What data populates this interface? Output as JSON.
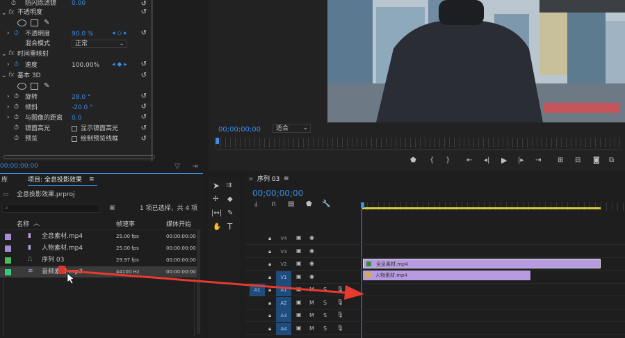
{
  "effect_controls": {
    "anti_flicker_label": "防闪烁滤镜",
    "anti_flicker_value": "0.00",
    "opacity_group": "不透明度",
    "opacity_label": "不透明度",
    "opacity_value": "90.0 %",
    "blend_label": "混合模式",
    "blend_value": "正常",
    "time_remap_group": "时间重映射",
    "speed_label": "速度",
    "speed_value": "100.00%",
    "basic3d_group": "基本 3D",
    "rotate_label": "旋转",
    "rotate_value": "28.0 °",
    "tilt_label": "倾斜",
    "tilt_value": "-20.0 °",
    "distance_label": "与图像的距离",
    "distance_value": "0.0",
    "specular_label": "镜面高光",
    "specular_checkbox": "显示镜面高光",
    "preview_label": "预览",
    "preview_checkbox": "绘制预览线框",
    "timecode": "00;00;00;00"
  },
  "program_monitor": {
    "timecode": "00;00;00;00",
    "fit_value": "适合"
  },
  "project": {
    "lib_tab": "库",
    "tab_title": "项目: 全息投影效果",
    "file_name": "全息投影效果.prproj",
    "selection_info": "1 项已选择，共 4 项",
    "col_name": "名称",
    "col_fps": "帧速率",
    "col_start": "媒体开始",
    "items": [
      {
        "name": "全息素材.mp4",
        "fps": "25.00 fps",
        "start": "00:00:00:00",
        "color": "#a98bd8"
      },
      {
        "name": "人物素材.mp4",
        "fps": "25.00 fps",
        "start": "00:00:00:00",
        "color": "#a98bd8"
      },
      {
        "name": "序列 03",
        "fps": "29.97 fps",
        "start": "00;00;00;00",
        "color": "#4bbf5a"
      },
      {
        "name": "音频素材.mp3",
        "fps": "44100 Hz",
        "start": "00:00:00:00",
        "color": "#2fcf7c"
      }
    ]
  },
  "timeline": {
    "seq_tab": "序列 03",
    "timecode": "00;00;00;00",
    "video_tracks": [
      "V4",
      "V3",
      "V2",
      "V1"
    ],
    "audio_tracks": [
      "A1",
      "A2",
      "A3",
      "A4"
    ],
    "source_patch": "A1",
    "mute_label": "M",
    "solo_label": "S",
    "clip_v2": "全息素材.mp4",
    "clip_v1": "人物素材.mp4"
  },
  "colors": {
    "accent": "#3a8ee6",
    "clip": "#b79be0",
    "arrow": "#e83a2e",
    "work_bar": "#d8c93a"
  }
}
